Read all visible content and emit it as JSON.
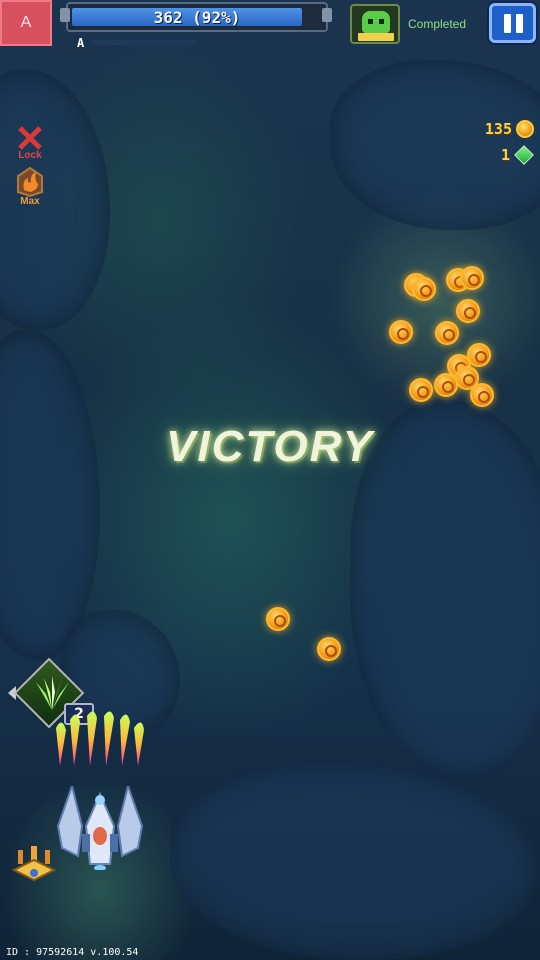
{
  "top_bar": {
    "left_button_label": "A",
    "hp_text": "362 (92%)",
    "hp_fraction": 0.92,
    "sub_label": "A",
    "status_text": "Completed"
  },
  "currencies": {
    "coins": "135",
    "gems": "1"
  },
  "skills": [
    {
      "label": "Lock",
      "icon": "locked-skill-icon",
      "color": "#d83a3a"
    },
    {
      "label": "Max",
      "icon": "flame-skill-icon",
      "color": "#e08a2c"
    }
  ],
  "victory_text": "VICTORY",
  "weapon": {
    "count": "2",
    "icon": "green-spread-weapon-icon"
  },
  "footer": {
    "id_text": "ID : 97592614 v.100.54"
  },
  "colors": {
    "accent_blue": "#1f5fc8",
    "hp_blue": "#3f7fd8",
    "coin_gold": "#ffd24a",
    "gem_green": "#4bd35a",
    "status_green": "#8ee07a"
  }
}
